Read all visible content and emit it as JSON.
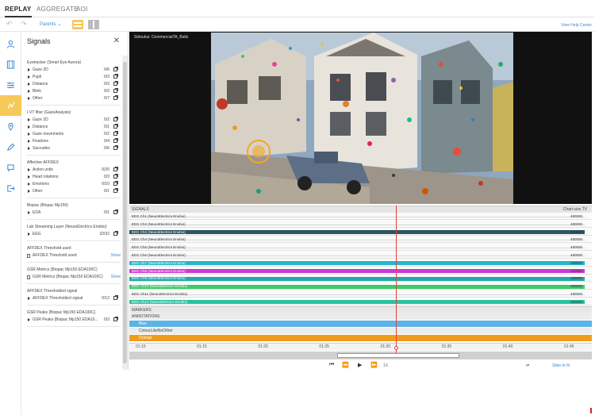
{
  "topnav": {
    "tabs": [
      {
        "label": "REPLAY",
        "active": true
      },
      {
        "label": "AGGREGATE",
        "active": false
      },
      {
        "label": "AOI",
        "active": false
      }
    ]
  },
  "toolbar": {
    "parents_label": "Parents",
    "help_label": "View Help Center"
  },
  "panel": {
    "title": "Signals",
    "groups": [
      {
        "title": "Eyetracker (Smart Eye Aurora)",
        "items": [
          {
            "label": "Gaze 2D",
            "count": "0/6"
          },
          {
            "label": "Pupil",
            "count": "0/3"
          },
          {
            "label": "Distance",
            "count": "0/3"
          },
          {
            "label": "Blink",
            "count": "0/3"
          },
          {
            "label": "Other",
            "count": "0/7"
          }
        ]
      },
      {
        "title": "I-VT filter (GazeAnalysis)",
        "items": [
          {
            "label": "Gaze 2D",
            "count": "0/2"
          },
          {
            "label": "Distance",
            "count": "0/1"
          },
          {
            "label": "Gaze movements",
            "count": "0/2"
          },
          {
            "label": "Fixations",
            "count": "0/4"
          },
          {
            "label": "Saccades",
            "count": "0/6"
          }
        ]
      },
      {
        "title": "Affective AFFDEX",
        "items": [
          {
            "label": "Action units",
            "count": "0/20"
          },
          {
            "label": "Head rotations",
            "count": "0/3"
          },
          {
            "label": "Emotions",
            "count": "0/10"
          },
          {
            "label": "Other",
            "count": "0/1"
          }
        ]
      },
      {
        "title": "Biopac (Biopac Mp150)",
        "items": [
          {
            "label": "EDA",
            "count": "0/1"
          }
        ]
      },
      {
        "title": "Lab Streaming Layer (NeuroElectrics Enobio)",
        "items": [
          {
            "label": "EEG",
            "count": "32/32"
          }
        ]
      },
      {
        "title": "AFFDEX Threshold used",
        "items": [
          {
            "label": "AFFDEX Threshold used",
            "count": "",
            "show": "Show",
            "box": true
          }
        ]
      },
      {
        "title": "GSR Metrics (Biopac Mp150 EDA100C)",
        "items": [
          {
            "label": "GSR Metrics (Biopac Mp150 EDA100C)",
            "count": "",
            "show": "Show",
            "box": true
          }
        ]
      },
      {
        "title": "AFFDEX Thresholded signal",
        "items": [
          {
            "label": "AFFDEX Thresholded signal",
            "count": "0/12"
          }
        ]
      },
      {
        "title": "GSR Peaks (Biopac Mp150 EDA100C)",
        "items": [
          {
            "label": "GSR Peaks (Biopac Mp150 EDA10...",
            "count": "0/3"
          }
        ]
      }
    ]
  },
  "video": {
    "stimulus_label": "Stimulus: CommercialTA_Balls"
  },
  "signals_strip": {
    "header": "SIGNALS",
    "chart_size": "Chart size  TV",
    "channels": [
      {
        "label": "EEG Ch1 (NeuroElectrics Enobio)",
        "value": "480000",
        "color": "#f2f2f2",
        "thin": true
      },
      {
        "label": "EEG Ch2 (NeuroElectrics Enobio)",
        "value": "480000",
        "color": "#f2f2f2",
        "thin": true
      },
      {
        "label": "EEG Ch3 (NeuroElectrics Enobio)",
        "value": "480000",
        "color": "#2d5560",
        "thin": false
      },
      {
        "label": "EEG Ch4 (NeuroElectrics Enobio)",
        "value": "480000",
        "color": "#f2f2f2",
        "thin": true
      },
      {
        "label": "EEG Ch5 (NeuroElectrics Enobio)",
        "value": "480000",
        "color": "#f2f2f2",
        "thin": true
      },
      {
        "label": "EEG Ch6 (NeuroElectrics Enobio)",
        "value": "480000",
        "color": "#f2f2f2",
        "thin": true
      },
      {
        "label": "EEG Ch7 (NeuroElectrics Enobio)",
        "value": "480000",
        "color": "#25b6c8",
        "thin": false
      },
      {
        "label": "EEG Ch8 (NeuroElectrics Enobio)",
        "value": "240000",
        "color": "#cc3bd4",
        "thin": false
      },
      {
        "label": "EEG Ch9 (NeuroElectrics Enobio)",
        "value": "480000",
        "color": "#23aaa8",
        "thin": false
      },
      {
        "label": "EEG Ch10 (NeuroElectrics Enobio)",
        "value": "480000",
        "color": "#3dcc6a",
        "thin": false
      },
      {
        "label": "EEG Ch11 (NeuroElectrics Enobio)",
        "value": "480000",
        "color": "#f2f2f2",
        "thin": true
      },
      {
        "label": "EEG Ch12 (NeuroElectrics Enobio)",
        "value": "480000",
        "color": "#27c3a0",
        "thin": false
      }
    ]
  },
  "markers": {
    "label": "MARKERS"
  },
  "annotations": {
    "label": "ANNOTATIONS",
    "bars": [
      {
        "label": "Blue",
        "color": "#5ab4e6"
      },
      {
        "label": "ColourLikeNoOther",
        "color": "#ececec"
      },
      {
        "label": "Orange",
        "color": "#f19b1a"
      }
    ]
  },
  "timeline": {
    "ticks": [
      "01:10",
      "01:15",
      "01:20",
      "01:25",
      "01:30",
      "01:35",
      "01:40",
      "01:45"
    ]
  },
  "playback": {
    "speed": "1X",
    "slide_label": "Slide to fit"
  },
  "colors": {
    "accent": "#f7c85a",
    "cursor": "#e04040",
    "link": "#3f8bd5"
  }
}
